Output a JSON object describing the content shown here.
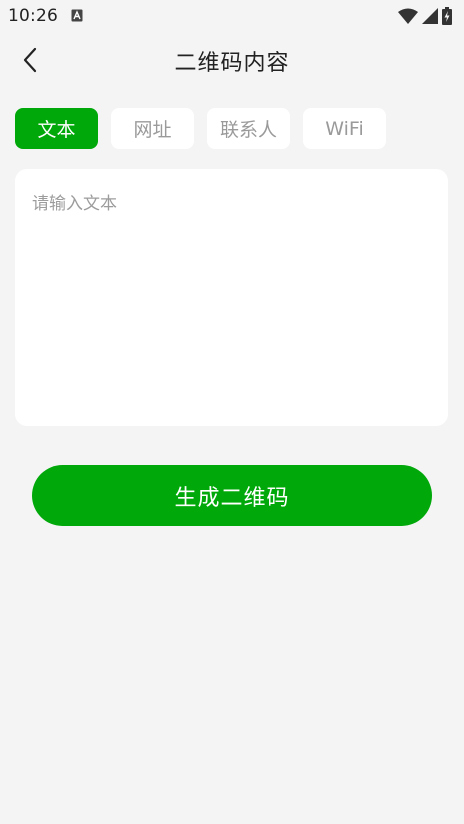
{
  "status_bar": {
    "time": "10:26",
    "icons": [
      "keyboard-notification-icon",
      "wifi-icon",
      "signal-icon",
      "battery-charging-icon"
    ]
  },
  "header": {
    "title": "二维码内容",
    "back_icon": "chevron-left-icon"
  },
  "tabs": [
    {
      "label": "文本",
      "active": true
    },
    {
      "label": "网址",
      "active": false
    },
    {
      "label": "联系人",
      "active": false
    },
    {
      "label": "WiFi",
      "active": false
    }
  ],
  "text_input": {
    "value": "",
    "placeholder": "请输入文本"
  },
  "generate_button": {
    "label": "生成二维码"
  },
  "colors": {
    "accent": "#00a80a",
    "background": "#f4f4f4",
    "card": "#ffffff",
    "inactive_text": "#9a9a9a"
  }
}
